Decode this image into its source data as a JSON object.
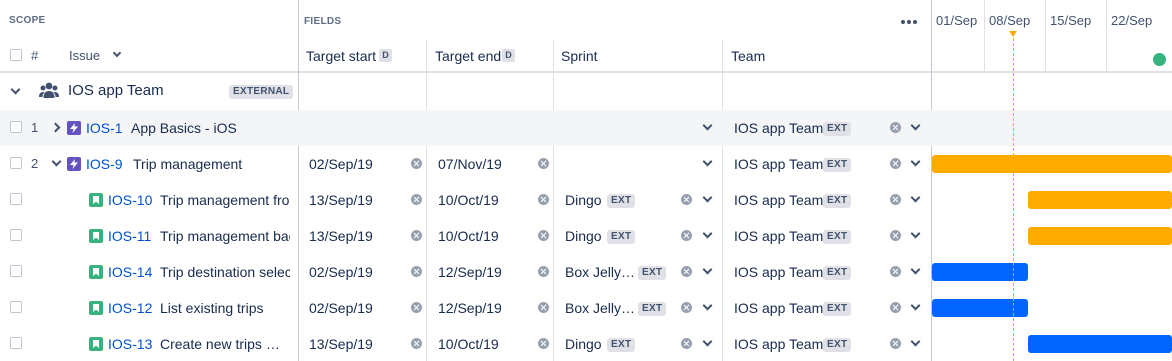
{
  "header": {
    "scope_label": "SCOPE",
    "fields_label": "FIELDS",
    "col_hash": "#",
    "col_issue": "Issue",
    "col_target_start": "Target start",
    "col_target_end": "Target end",
    "col_sprint": "Sprint",
    "col_team": "Team",
    "date_badge": "D",
    "timeline_dates": [
      "01/Sep",
      "08/Sep",
      "15/Sep",
      "22/Sep"
    ]
  },
  "group": {
    "name": "IOS app Team",
    "badge": "EXTERNAL"
  },
  "rows": [
    {
      "num": "1",
      "key": "IOS-1",
      "summary": "App Basics - iOS",
      "start": "",
      "end": "",
      "sprint": "",
      "sprint_badge": "",
      "team": "IOS app Team",
      "team_badge": "EXT"
    },
    {
      "num": "2",
      "key": "IOS-9",
      "summary": "Trip management",
      "start": "02/Sep/19",
      "end": "07/Nov/19",
      "sprint": "",
      "sprint_badge": "",
      "team": "IOS app Team",
      "team_badge": "EXT"
    },
    {
      "num": "",
      "key": "IOS-10",
      "summary": "Trip management fron",
      "start": "13/Sep/19",
      "end": "10/Oct/19",
      "sprint": "Dingo",
      "sprint_badge": "EXT",
      "team": "IOS app Team",
      "team_badge": "EXT"
    },
    {
      "num": "",
      "key": "IOS-11",
      "summary": "Trip management back",
      "start": "13/Sep/19",
      "end": "10/Oct/19",
      "sprint": "Dingo",
      "sprint_badge": "EXT",
      "team": "IOS app Team",
      "team_badge": "EXT"
    },
    {
      "num": "",
      "key": "IOS-14",
      "summary": "Trip destination select",
      "start": "02/Sep/19",
      "end": "12/Sep/19",
      "sprint": "Box Jelly…",
      "sprint_badge": "EXT",
      "team": "IOS app Team",
      "team_badge": "EXT"
    },
    {
      "num": "",
      "key": "IOS-12",
      "summary": "List existing trips",
      "start": "02/Sep/19",
      "end": "12/Sep/19",
      "sprint": "Box Jelly…",
      "sprint_badge": "EXT",
      "team": "IOS app Team",
      "team_badge": "EXT"
    },
    {
      "num": "",
      "key": "IOS-13",
      "summary": "Create new trips …",
      "start": "13/Sep/19",
      "end": "10/Oct/19",
      "sprint": "Dingo",
      "sprint_badge": "EXT",
      "team": "IOS app Team",
      "team_badge": "EXT"
    }
  ],
  "colors": {
    "bar_orange": "#ffab00",
    "bar_blue": "#0065ff",
    "today_marker": "#ffab00",
    "link": "#0052cc",
    "status_dot": "#36b37e"
  }
}
